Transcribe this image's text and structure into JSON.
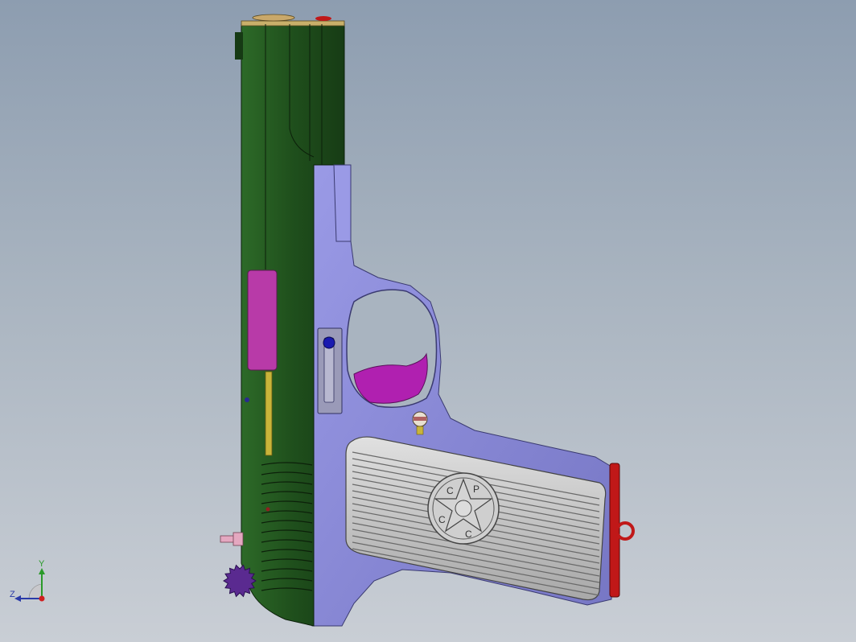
{
  "viewport": {
    "background_top": "#8d9db0",
    "background_bottom": "#c9ced5"
  },
  "model": {
    "description_icon": "pistol-3d-model",
    "colors": {
      "slide": "#1e4a1a",
      "frame": "#8c8cd8",
      "grip_panel": "#c8c8c8",
      "trigger": "#b020b0",
      "magazine_base": "#c01818",
      "hammer": "#5a2a90",
      "ejection_port": "#b83aa8",
      "barrel_rod": "#c8b43a"
    },
    "grip_emblem_letters": [
      "C",
      "C",
      "C",
      "P"
    ]
  },
  "triad": {
    "y_label": "Y",
    "z_label": "Z",
    "y_color": "#2a9a2a",
    "z_color": "#2a3aa8",
    "origin_color": "#d02020"
  }
}
